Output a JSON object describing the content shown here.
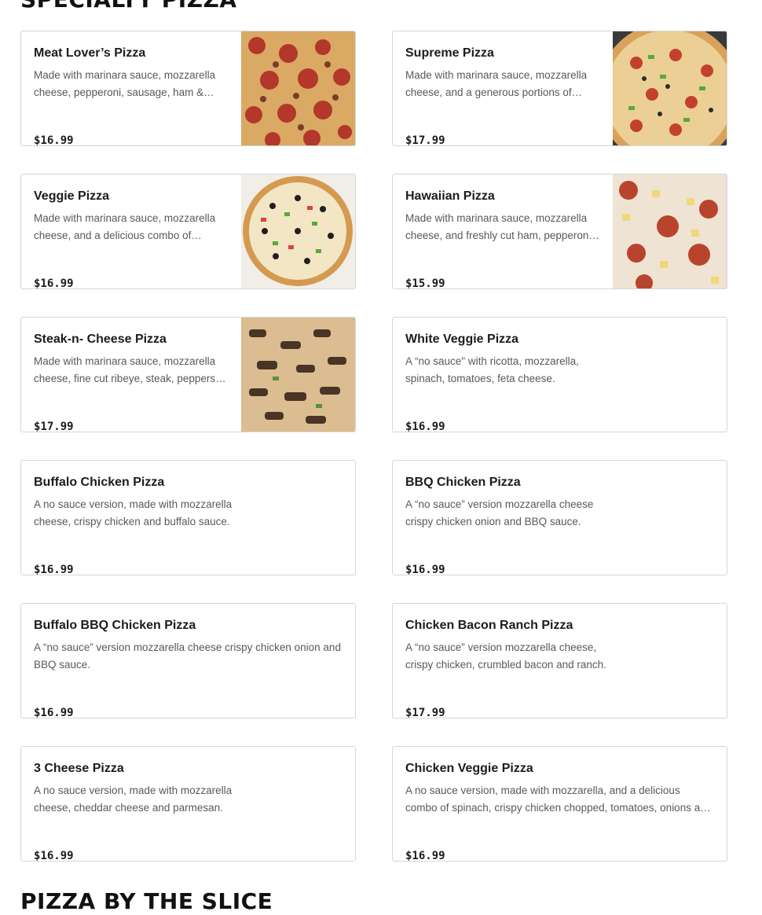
{
  "sections": {
    "specialty_title": "SPECIALTY PIZZA",
    "slice_title": "PIZZA BY THE SLICE"
  },
  "items": [
    {
      "name": "Meat Lover’s Pizza",
      "desc": "Made with marinara sauce, mozzarella cheese, pepperoni, sausage, ham & bacon.",
      "price": "$16.99",
      "image": "pizza-pepperoni-photo"
    },
    {
      "name": "Supreme Pizza",
      "desc": "Made with marinara sauce, mozzarella cheese, and a generous portions of toppings.",
      "price": "$17.99",
      "image": "pizza-supreme-photo"
    },
    {
      "name": "Veggie Pizza",
      "desc": "Made with marinara sauce, mozzarella cheese, and a delicious combo of vegetables.",
      "price": "$16.99",
      "image": "pizza-veggie-photo"
    },
    {
      "name": "Hawaiian Pizza",
      "desc": "Made with marinara sauce, mozzarella cheese, and freshly cut ham, pepperoni and pineapple.",
      "price": "$15.99",
      "image": "pizza-hawaiian-photo"
    },
    {
      "name": "Steak-n- Cheese Pizza",
      "desc": "Made with marinara sauce, mozzarella cheese, fine cut ribeye, steak, peppers and onions.",
      "price": "$17.99",
      "image": "pizza-steak-photo"
    },
    {
      "name": "White Veggie Pizza",
      "desc": "A “no sauce\" with ricotta, mozzarella, spinach, tomatoes, feta cheese.",
      "price": "$16.99"
    },
    {
      "name": "Buffalo Chicken Pizza",
      "desc": "A no sauce version, made with mozzarella cheese, crispy chicken and buffalo sauce.",
      "price": "$16.99"
    },
    {
      "name": "BBQ Chicken Pizza",
      "desc": "A “no sauce” version mozzarella cheese crispy chicken onion and BBQ sauce.",
      "price": "$16.99"
    },
    {
      "name": "Buffalo BBQ Chicken Pizza",
      "desc": "A “no sauce” version mozzarella cheese crispy chicken onion and BBQ sauce.",
      "price": "$16.99"
    },
    {
      "name": "Chicken Bacon Ranch Pizza",
      "desc": "A “no sauce” version mozzarella cheese, crispy chicken, crumbled bacon and ranch.",
      "price": "$17.99"
    },
    {
      "name": "3 Cheese Pizza",
      "desc": "A no sauce version, made with mozzarella cheese, cheddar cheese and parmesan.",
      "price": "$16.99"
    },
    {
      "name": "Chicken Veggie Pizza",
      "desc": "A no sauce version, made with mozzarella, and a delicious combo of spinach, crispy chicken chopped, tomatoes, onions and peppers.",
      "price": "$16.99"
    }
  ]
}
